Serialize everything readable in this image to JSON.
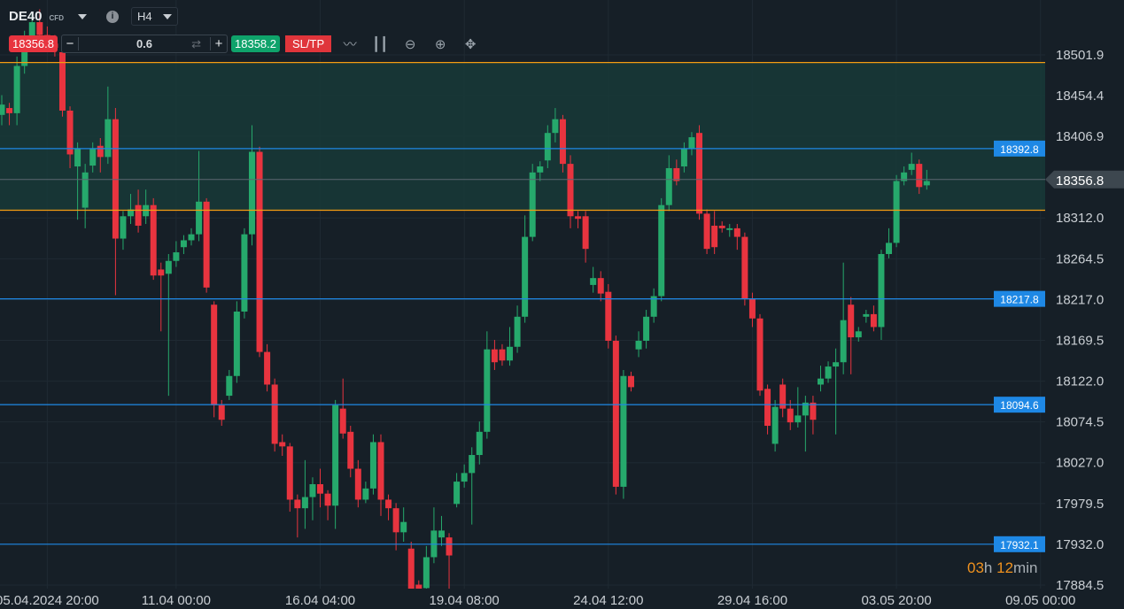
{
  "header": {
    "symbol": "DE40",
    "type": "CFD",
    "timeframe": "H4",
    "info_icon": "info-icon"
  },
  "trade": {
    "sell_price": "18356.8",
    "quantity": "0.6",
    "buy_price": "18358.2",
    "sltp_label": "SL/TP",
    "minus": "−",
    "plus": "+"
  },
  "tools": [
    "line-chart-icon",
    "candlestick-icon",
    "zoom-out-icon",
    "zoom-in-icon",
    "move-icon"
  ],
  "timer": {
    "hours": "03",
    "h": "h ",
    "minutes": "12",
    "min": "min"
  },
  "colors": {
    "up": "#26a96c",
    "down": "#e8343f",
    "level_blue": "#1e88e5",
    "level_orange": "#f39c12",
    "zone": "#173a38",
    "background": "#161f27"
  },
  "chart_data": {
    "type": "candlestick",
    "y_ticks": [
      18501.9,
      18454.4,
      18406.9,
      18312.0,
      18264.5,
      18217.0,
      18169.5,
      18122.0,
      18074.5,
      18027.0,
      17979.5,
      17932.0,
      17884.5
    ],
    "y_tick_labels": [
      "18501.9",
      "18454.4",
      "18406.9",
      "18312.0",
      "18264.5",
      "18217.0",
      "18169.5",
      "18122.0",
      "18074.5",
      "18027.0",
      "17979.5",
      "17932.0",
      "17884.5"
    ],
    "ylim": [
      17884.5,
      18501.9
    ],
    "x_labels": [
      {
        "index": 6,
        "label": "05.04.2024 20:00"
      },
      {
        "index": 23,
        "label": "11.04 00:00"
      },
      {
        "index": 42,
        "label": "16.04 04:00"
      },
      {
        "index": 61,
        "label": "19.04 08:00"
      },
      {
        "index": 80,
        "label": "24.04 12:00"
      },
      {
        "index": 99,
        "label": "29.04 16:00"
      },
      {
        "index": 118,
        "label": "03.05 20:00"
      },
      {
        "index": 137,
        "label": "09.05 00:00"
      }
    ],
    "current_price": {
      "value": 18356.8,
      "label": "18356.8"
    },
    "levels": [
      {
        "value": 18392.8,
        "label": "18392.8",
        "color": "blue"
      },
      {
        "value": 18217.8,
        "label": "18217.8",
        "color": "blue"
      },
      {
        "value": 18094.6,
        "label": "18094.6",
        "color": "blue"
      },
      {
        "value": 17932.1,
        "label": "17932.1",
        "color": "blue"
      }
    ],
    "zone": {
      "from": 18321,
      "to": 18493,
      "color": "orange"
    },
    "candles_ohlc": [
      [
        18432,
        18444,
        18455,
        18420
      ],
      [
        18440,
        18434,
        18446,
        18420
      ],
      [
        18434,
        18489,
        18500,
        18420
      ],
      [
        18489,
        18520,
        18530,
        18480
      ],
      [
        18520,
        18540,
        18550,
        18510
      ],
      [
        18540,
        18525,
        18555,
        18515
      ],
      [
        18525,
        18515,
        18535,
        18505
      ],
      [
        18515,
        18510,
        18525,
        18500
      ],
      [
        18505,
        18437,
        18515,
        18430
      ],
      [
        18437,
        18386,
        18442,
        18370
      ],
      [
        18372,
        18393,
        18400,
        18310
      ],
      [
        18324,
        18365,
        18375,
        18300
      ],
      [
        18373,
        18393,
        18400,
        18365
      ],
      [
        18396,
        18383,
        18405,
        18365
      ],
      [
        18383,
        18427,
        18465,
        18375
      ],
      [
        18427,
        18288,
        18440,
        18222
      ],
      [
        18288,
        18314,
        18320,
        18275
      ],
      [
        18314,
        18322,
        18340,
        18305
      ],
      [
        18327,
        18303,
        18345,
        18295
      ],
      [
        18314,
        18327,
        18345,
        18305
      ],
      [
        18327,
        18245,
        18335,
        18240
      ],
      [
        18252,
        18245,
        18260,
        18180
      ],
      [
        18247,
        18262,
        18270,
        18105
      ],
      [
        18262,
        18272,
        18285,
        18255
      ],
      [
        18278,
        18286,
        18292,
        18270
      ],
      [
        18286,
        18293,
        18300,
        18280
      ],
      [
        18293,
        18331,
        18390,
        18285
      ],
      [
        18331,
        18231,
        18335,
        18225
      ],
      [
        18211,
        18094,
        18215,
        18080
      ],
      [
        18094,
        18077,
        18100,
        18070
      ],
      [
        18105,
        18128,
        18135,
        18100
      ],
      [
        18128,
        18203,
        18215,
        18120
      ],
      [
        18203,
        18293,
        18300,
        18195
      ],
      [
        18293,
        18389,
        18420,
        18280
      ],
      [
        18389,
        18156,
        18395,
        18150
      ],
      [
        18156,
        18118,
        18165,
        18110
      ],
      [
        18118,
        18049,
        18125,
        18040
      ],
      [
        18051,
        18046,
        18060,
        18035
      ],
      [
        18046,
        17984,
        18050,
        17970
      ],
      [
        17984,
        17974,
        17990,
        17940
      ],
      [
        17974,
        17987,
        18030,
        17950
      ],
      [
        17987,
        18002,
        18010,
        17960
      ],
      [
        18002,
        17991,
        18020,
        17975
      ],
      [
        17991,
        17977,
        17995,
        17960
      ],
      [
        17977,
        18094,
        18100,
        17950
      ],
      [
        18090,
        18061,
        18125,
        18055
      ],
      [
        18063,
        18020,
        18070,
        18010
      ],
      [
        18020,
        17984,
        18030,
        17975
      ],
      [
        17984,
        17997,
        18005,
        17980
      ],
      [
        17997,
        18051,
        18060,
        17990
      ],
      [
        18051,
        17984,
        18060,
        17965
      ],
      [
        17984,
        17974,
        17990,
        17960
      ],
      [
        17974,
        17946,
        17980,
        17925
      ],
      [
        17946,
        17958,
        17975,
        17935
      ],
      [
        17927,
        17871,
        17935,
        17860
      ],
      [
        17885,
        17875,
        17890,
        17860
      ],
      [
        17881,
        17917,
        17930,
        17870
      ],
      [
        17917,
        17948,
        17975,
        17910
      ],
      [
        17940,
        17948,
        17965,
        17930
      ],
      [
        17940,
        17919,
        17945,
        17880
      ],
      [
        17979,
        18005,
        18015,
        17975
      ],
      [
        18005,
        18015,
        18025,
        17998
      ],
      [
        18015,
        18036,
        18045,
        17955
      ],
      [
        18036,
        18063,
        18075,
        18025
      ],
      [
        18063,
        18159,
        18180,
        18055
      ],
      [
        18159,
        18144,
        18170,
        18135
      ],
      [
        18159,
        18146,
        18165,
        18140
      ],
      [
        18146,
        18162,
        18185,
        18140
      ],
      [
        18162,
        18197,
        18210,
        18155
      ],
      [
        18197,
        18290,
        18315,
        18190
      ],
      [
        18290,
        18365,
        18375,
        18285
      ],
      [
        18365,
        18372,
        18378,
        18355
      ],
      [
        18379,
        18411,
        18420,
        18370
      ],
      [
        18411,
        18427,
        18440,
        18400
      ],
      [
        18427,
        18375,
        18432,
        18365
      ],
      [
        18375,
        18314,
        18385,
        18300
      ],
      [
        18314,
        18311,
        18320,
        18300
      ],
      [
        18314,
        18276,
        18320,
        18260
      ],
      [
        18234,
        18242,
        18255,
        18225
      ],
      [
        18242,
        18224,
        18250,
        18215
      ],
      [
        18226,
        18169,
        18235,
        18160
      ],
      [
        18169,
        17999,
        18175,
        17990
      ],
      [
        17999,
        18128,
        18135,
        17985
      ],
      [
        18128,
        18115,
        18133,
        18110
      ],
      [
        18159,
        18169,
        18180,
        18150
      ],
      [
        18169,
        18197,
        18205,
        18160
      ],
      [
        18197,
        18221,
        18230,
        18190
      ],
      [
        18221,
        18327,
        18335,
        18215
      ],
      [
        18327,
        18370,
        18385,
        18320
      ],
      [
        18370,
        18355,
        18380,
        18350
      ],
      [
        18372,
        18393,
        18400,
        18365
      ],
      [
        18393,
        18406,
        18412,
        18385
      ],
      [
        18411,
        18317,
        18420,
        18310
      ],
      [
        18317,
        18276,
        18322,
        18270
      ],
      [
        18303,
        18278,
        18320,
        18270
      ],
      [
        18303,
        18300,
        18308,
        18295
      ],
      [
        18298,
        18300,
        18305,
        18290
      ],
      [
        18300,
        18290,
        18305,
        18275
      ],
      [
        18290,
        18218,
        18295,
        18210
      ],
      [
        18218,
        18195,
        18225,
        18185
      ],
      [
        18195,
        18111,
        18200,
        18105
      ],
      [
        18113,
        18070,
        18118,
        18060
      ],
      [
        18049,
        18092,
        18100,
        18040
      ],
      [
        18118,
        18090,
        18125,
        18080
      ],
      [
        18090,
        18074,
        18100,
        18065
      ],
      [
        18074,
        18082,
        18115,
        18068
      ],
      [
        18082,
        18097,
        18105,
        18040
      ],
      [
        18097,
        18077,
        18105,
        18060
      ],
      [
        18118,
        18125,
        18140,
        18110
      ],
      [
        18125,
        18139,
        18145,
        18120
      ],
      [
        18139,
        18144,
        18160,
        18060
      ],
      [
        18144,
        18193,
        18260,
        18130
      ],
      [
        18211,
        18173,
        18220,
        18130
      ],
      [
        18173,
        18180,
        18185,
        18168
      ],
      [
        18197,
        18200,
        18205,
        18190
      ],
      [
        18200,
        18185,
        18210,
        18180
      ],
      [
        18185,
        18270,
        18275,
        18170
      ],
      [
        18270,
        18283,
        18300,
        18265
      ],
      [
        18283,
        18355,
        18362,
        18278
      ],
      [
        18355,
        18365,
        18372,
        18350
      ],
      [
        18368,
        18375,
        18388,
        18362
      ],
      [
        18375,
        18348,
        18380,
        18340
      ],
      [
        18350,
        18355,
        18368,
        18345
      ]
    ]
  }
}
